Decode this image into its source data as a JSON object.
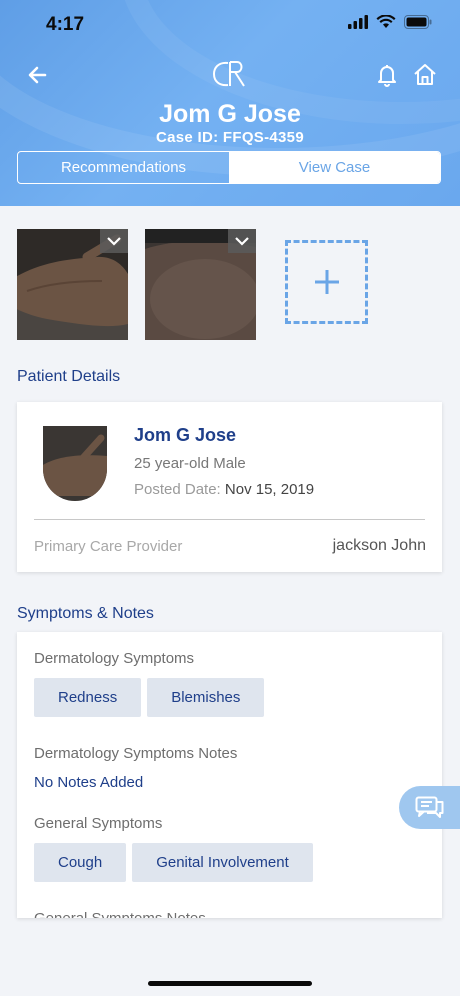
{
  "status_bar": {
    "time": "4:17"
  },
  "header": {
    "patient_name": "Jom G Jose",
    "case_id": "Case ID: FFQS-4359",
    "tabs": [
      {
        "label": "Recommendations",
        "active": true
      },
      {
        "label": "View Case",
        "active": false
      }
    ],
    "logo_text": "CR"
  },
  "patient_details": {
    "section_title": "Patient Details",
    "name": "Jom G Jose",
    "age_gender": "25 year-old Male",
    "posted_label": "Posted Date:",
    "posted_value": "Nov 15, 2019",
    "pcp_label": "Primary Care Provider",
    "pcp_value": "jackson John"
  },
  "symptoms": {
    "section_title": "Symptoms & Notes",
    "derm_label": "Dermatology Symptoms",
    "derm_chips": [
      "Redness",
      "Blemishes"
    ],
    "derm_notes_label": "Dermatology Symptoms Notes",
    "derm_notes_value": "No Notes Added",
    "general_label": "General Symptoms",
    "general_chips": [
      "Cough",
      "Genital Involvement"
    ],
    "general_notes_label": "General Symptoms Notes"
  },
  "colors": {
    "accent": "#6aa5e6",
    "navy": "#1f3f8a",
    "chip_bg": "#dfe5ee"
  }
}
